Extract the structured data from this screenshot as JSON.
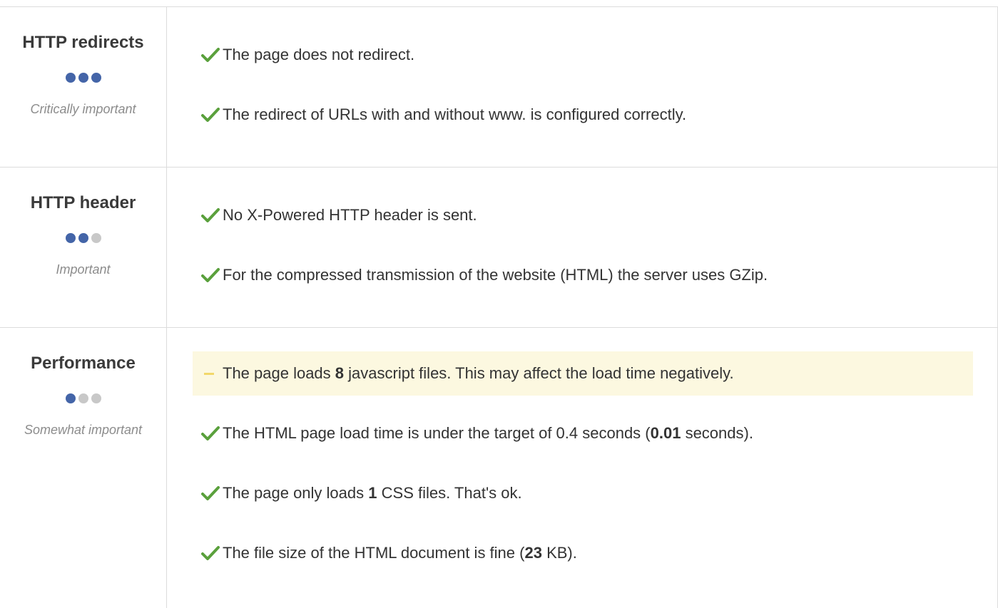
{
  "colors": {
    "check": "#5aa03c",
    "dot_on": "#4465a8",
    "dot_off": "#c8c8c8",
    "warn_bg": "#fcf8e0",
    "warn_dash": "#f2d86a"
  },
  "sections": [
    {
      "title": "HTTP redirects",
      "importance_label": "Critically important",
      "importance_level": 3,
      "items": [
        {
          "status": "ok",
          "text": "The page does not redirect."
        },
        {
          "status": "ok",
          "text": "The redirect of URLs with and without www. is configured correctly."
        }
      ]
    },
    {
      "title": "HTTP header",
      "importance_label": "Important",
      "importance_level": 2,
      "items": [
        {
          "status": "ok",
          "text": "No X-Powered HTTP header is sent."
        },
        {
          "status": "ok",
          "text": "For the compressed transmission of the website (HTML) the server uses GZip."
        }
      ]
    },
    {
      "title": "Performance",
      "importance_label": "Somewhat important",
      "importance_level": 1,
      "items": [
        {
          "status": "warning",
          "pre": "The page loads ",
          "bold": "8",
          "post": " javascript files. This may affect the load time negatively."
        },
        {
          "status": "ok",
          "pre": "The HTML page load time is under the target of 0.4 seconds (",
          "bold": "0.01",
          "post": " seconds)."
        },
        {
          "status": "ok",
          "pre": "The page only loads ",
          "bold": "1",
          "post": " CSS files. That's ok."
        },
        {
          "status": "ok",
          "pre": "The file size of the HTML document is fine (",
          "bold": "23",
          "post": " KB)."
        }
      ]
    }
  ]
}
